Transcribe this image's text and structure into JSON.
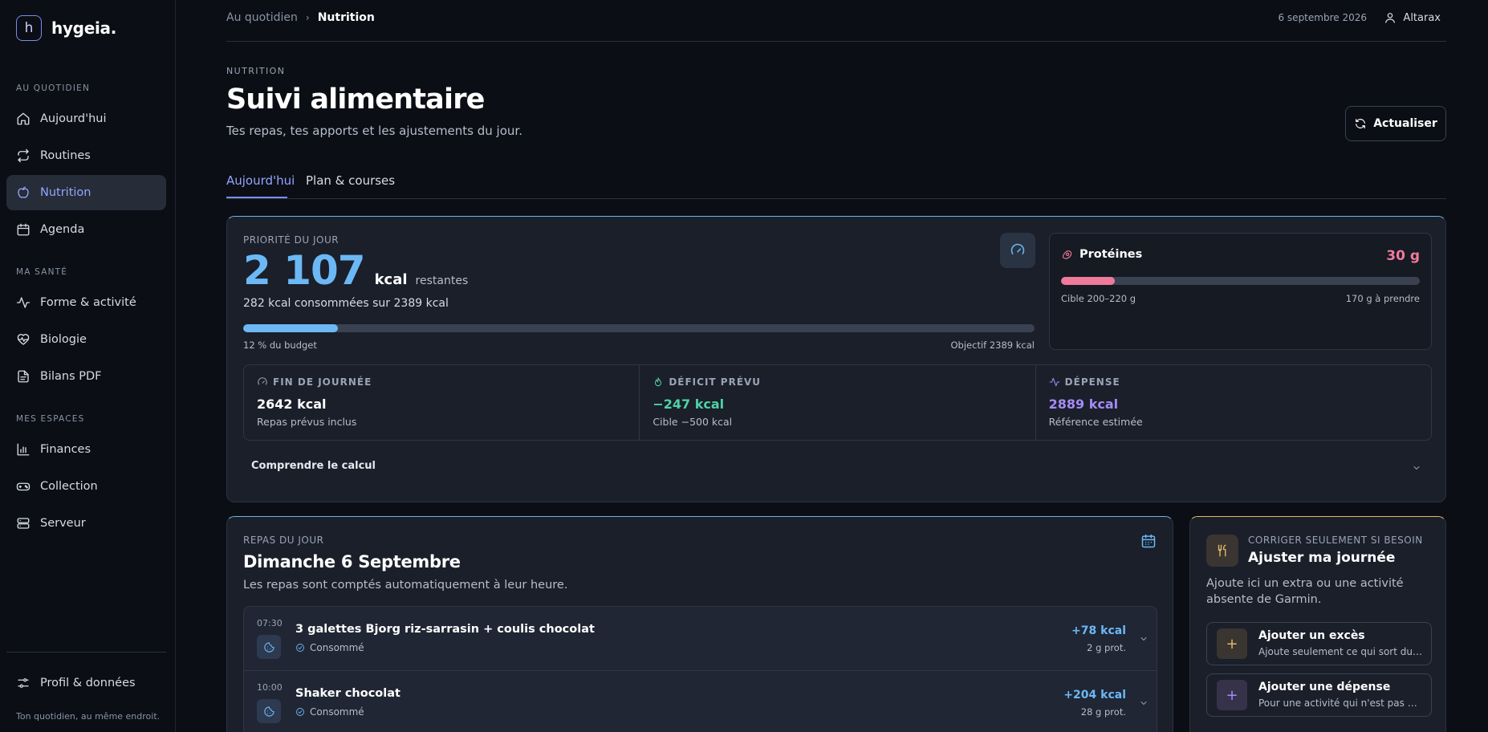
{
  "brand": {
    "logo_letter": "h",
    "name": "hygeia."
  },
  "sidebar": {
    "sections": [
      {
        "label": "Au quotidien",
        "items": [
          {
            "label": "Aujourd'hui",
            "icon": "home-icon"
          },
          {
            "label": "Routines",
            "icon": "repeat-icon"
          },
          {
            "label": "Nutrition",
            "icon": "apple-icon",
            "active": true
          },
          {
            "label": "Agenda",
            "icon": "calendar-icon"
          }
        ]
      },
      {
        "label": "Ma santé",
        "items": [
          {
            "label": "Forme & activité",
            "icon": "activity-icon"
          },
          {
            "label": "Biologie",
            "icon": "heart-pulse-icon"
          },
          {
            "label": "Bilans PDF",
            "icon": "file-icon"
          }
        ]
      },
      {
        "label": "Mes espaces",
        "items": [
          {
            "label": "Finances",
            "icon": "bar-chart-icon"
          },
          {
            "label": "Collection",
            "icon": "gamepad-icon"
          },
          {
            "label": "Serveur",
            "icon": "server-icon"
          }
        ]
      }
    ],
    "footer_item": {
      "label": "Profil & données",
      "icon": "sliders-icon"
    },
    "tagline": "Ton quotidien, au même endroit."
  },
  "topbar": {
    "breadcrumb": [
      "Au quotidien",
      "Nutrition"
    ],
    "date": "6 septembre 2026",
    "user": "Altarax"
  },
  "header": {
    "eyebrow": "NUTRITION",
    "title": "Suivi alimentaire",
    "subtitle": "Tes repas, tes apports et les ajustements du jour.",
    "refresh_label": "Actualiser"
  },
  "tabs": [
    {
      "label": "Aujourd'hui",
      "active": true
    },
    {
      "label": "Plan & courses",
      "active": false
    }
  ],
  "priority": {
    "eyebrow": "PRIORITÉ DU JOUR",
    "remaining": "2 107",
    "unit": "kcal",
    "remaining_label": "restantes",
    "consumed_text": "282 kcal consommées sur 2389 kcal",
    "budget_fraction": 0.12,
    "budget_label": "12 % du budget",
    "goal_label": "Objectif 2389 kcal"
  },
  "protein": {
    "label": "Protéines",
    "value": "30 g",
    "fraction": 0.15,
    "target_label": "Cible 200–220 g",
    "remaining_label": "170 g à prendre"
  },
  "stats": [
    {
      "label": "FIN DE JOURNÉE",
      "icon": "gauge-icon",
      "value": "2642 kcal",
      "sub": "Repas prévus inclus",
      "color": "#ffffff"
    },
    {
      "label": "DÉFICIT PRÉVU",
      "icon": "flame-icon",
      "value": "−247 kcal",
      "sub": "Cible −500 kcal",
      "color": "#4fd1a5"
    },
    {
      "label": "DÉPENSE",
      "icon": "activity-icon",
      "value": "2889 kcal",
      "sub": "Référence estimée",
      "color": "#a58bf5"
    }
  ],
  "calc_label": "Comprendre le calcul",
  "meals_card": {
    "eyebrow": "REPAS DU JOUR",
    "title": "Dimanche 6 Septembre",
    "subtitle": "Les repas sont comptés automatiquement à leur heure.",
    "meals": [
      {
        "time": "07:30",
        "name": "3 galettes Bjorg riz-sarrasin + coulis chocolat",
        "status": "Consommé",
        "kcal": "+78 kcal",
        "prot": "2 g prot."
      },
      {
        "time": "10:00",
        "name": "Shaker chocolat",
        "status": "Consommé",
        "kcal": "+204 kcal",
        "prot": "28 g prot."
      }
    ]
  },
  "adjust_card": {
    "eyebrow": "CORRIGER SEULEMENT SI BESOIN",
    "title": "Ajuster ma journée",
    "description": "Ajoute ici un extra ou une activité absente de Garmin.",
    "actions": [
      {
        "title": "Ajouter un excès",
        "sub": "Ajoute seulement ce qui sort du plan",
        "accent": "#e3b76a",
        "bg": "#3a3530"
      },
      {
        "title": "Ajouter une dépense",
        "sub": "Pour une activité qui n'est pas déjà comptée",
        "accent": "#a58bf5",
        "bg": "#35324a"
      }
    ]
  },
  "colors": {
    "accent": "#7c8cf0",
    "kcal": "#6cb8f5",
    "protein": "#f07a9a"
  }
}
